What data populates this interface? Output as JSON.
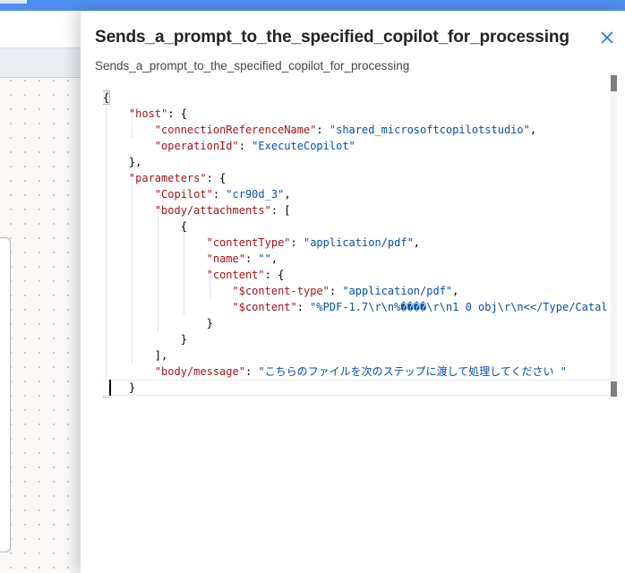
{
  "panel": {
    "title": "Sends_a_prompt_to_the_specified_copilot_for_processing",
    "subtitle": "Sends_a_prompt_to_the_specified_copilot_for_processing",
    "close_icon": "close-icon"
  },
  "code": {
    "open_brace": "{",
    "host_key": "\"host\"",
    "host_open": ": {",
    "conn_key": "\"connectionReferenceName\"",
    "conn_val": "\"shared_microsoftcopilotstudio\"",
    "op_key": "\"operationId\"",
    "op_val": "\"ExecuteCopilot\"",
    "host_close": "},",
    "params_key": "\"parameters\"",
    "params_open": ": {",
    "copilot_key": "\"Copilot\"",
    "copilot_val": "\"cr90d_3\"",
    "attach_key": "\"body/attachments\"",
    "attach_open": ": [",
    "obj_open": "{",
    "ctype_key": "\"contentType\"",
    "ctype_val": "\"application/pdf\"",
    "name_key": "\"name\"",
    "name_val": "\"\"",
    "content_key": "\"content\"",
    "content_open": ": {",
    "sctype_key": "\"$content-type\"",
    "sctype_val": "\"application/pdf\"",
    "scontent_key": "\"$content\"",
    "scontent_val": "\"%PDF-1.7\\r\\n%����\\r\\n1 0 obj\\r\\n<</Type/Catal",
    "content_close": "}",
    "obj_close": "}",
    "attach_close": "],",
    "msg_key": "\"body/message\"",
    "msg_val": "\"こちらのファイルを次のステップに渡して処理してください \"",
    "params_close": "}",
    "close_brace": "}"
  }
}
